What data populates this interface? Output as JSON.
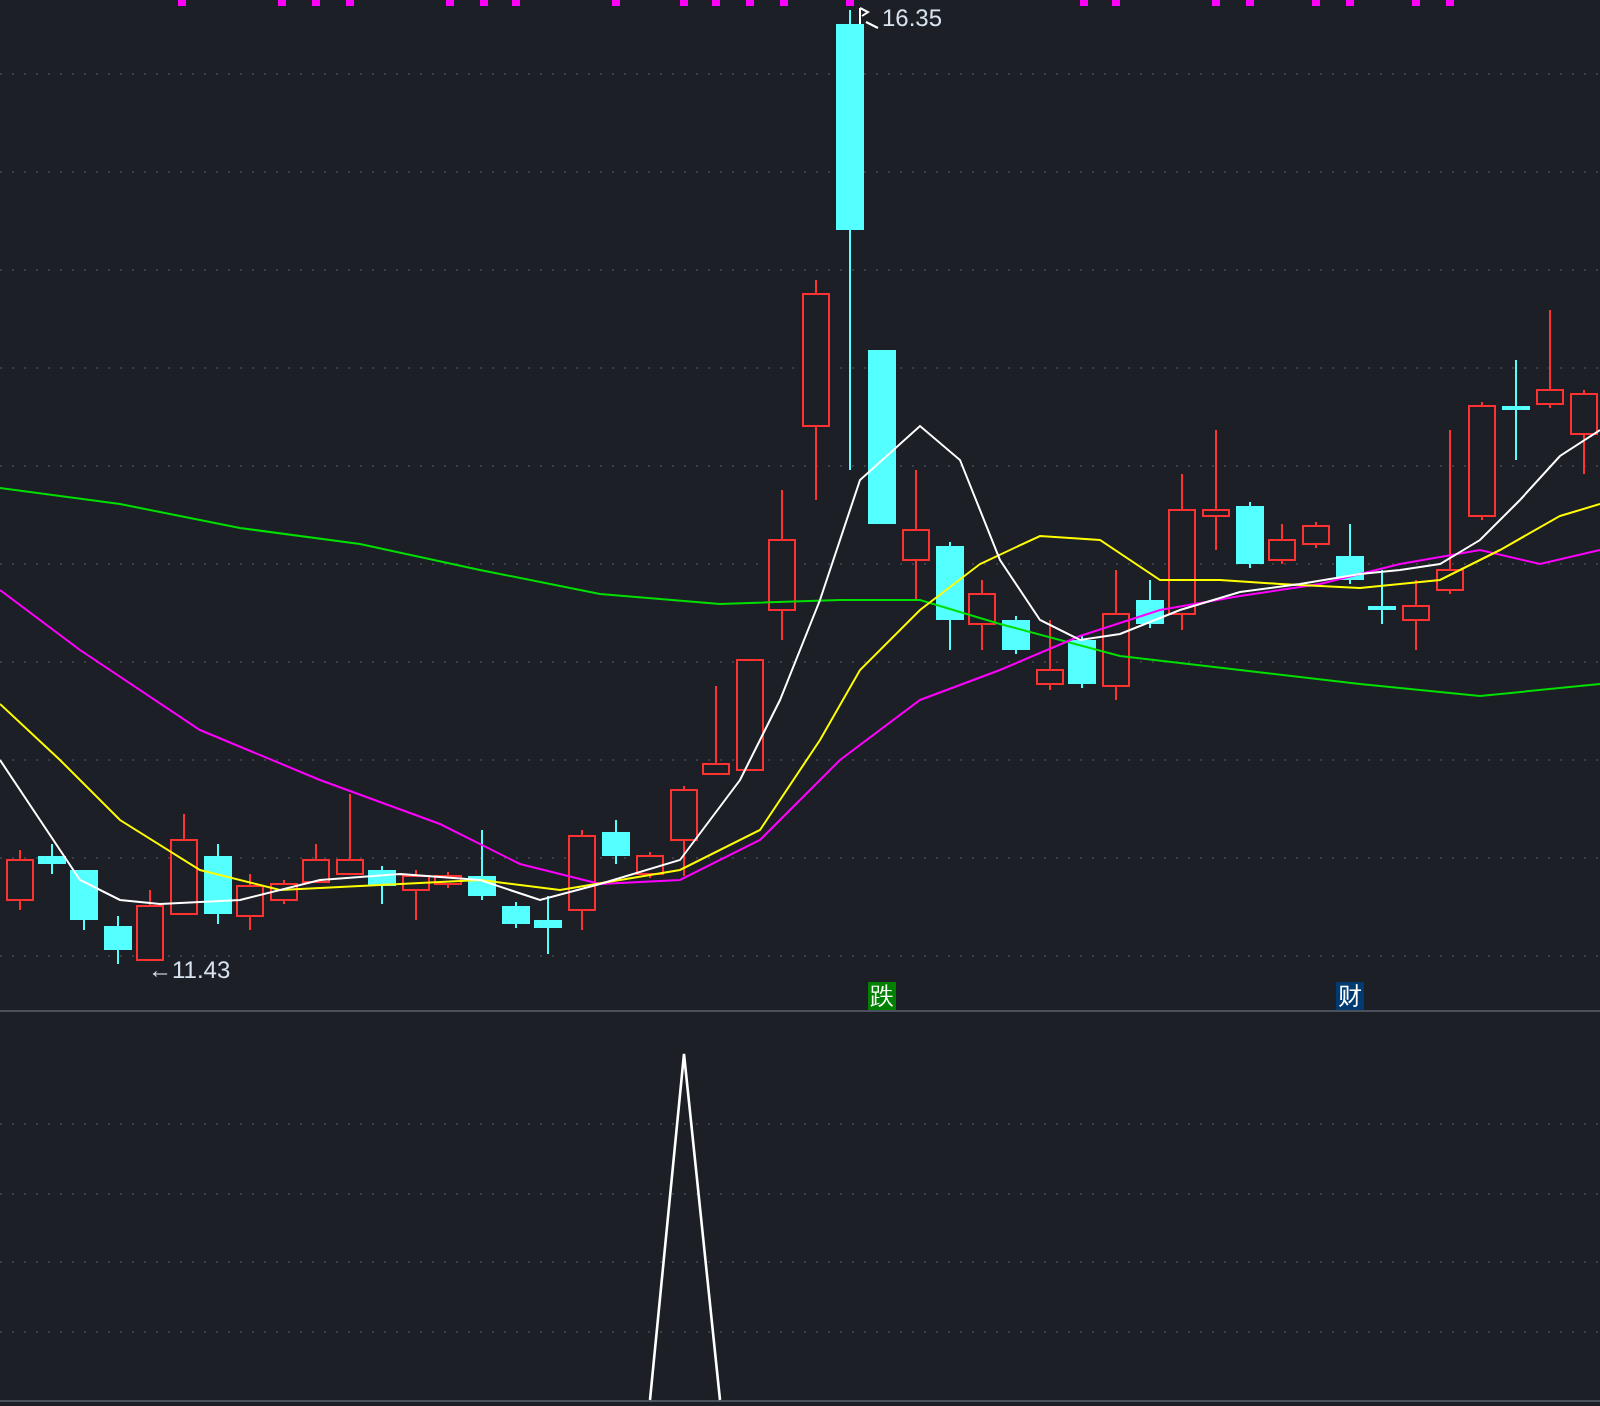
{
  "price_chart": {
    "high_label": "16.35",
    "low_label": "←11.43"
  },
  "signals": [
    {
      "text": "跌",
      "color": "#008000"
    },
    {
      "text": "财",
      "color": "#003a70"
    }
  ]
}
